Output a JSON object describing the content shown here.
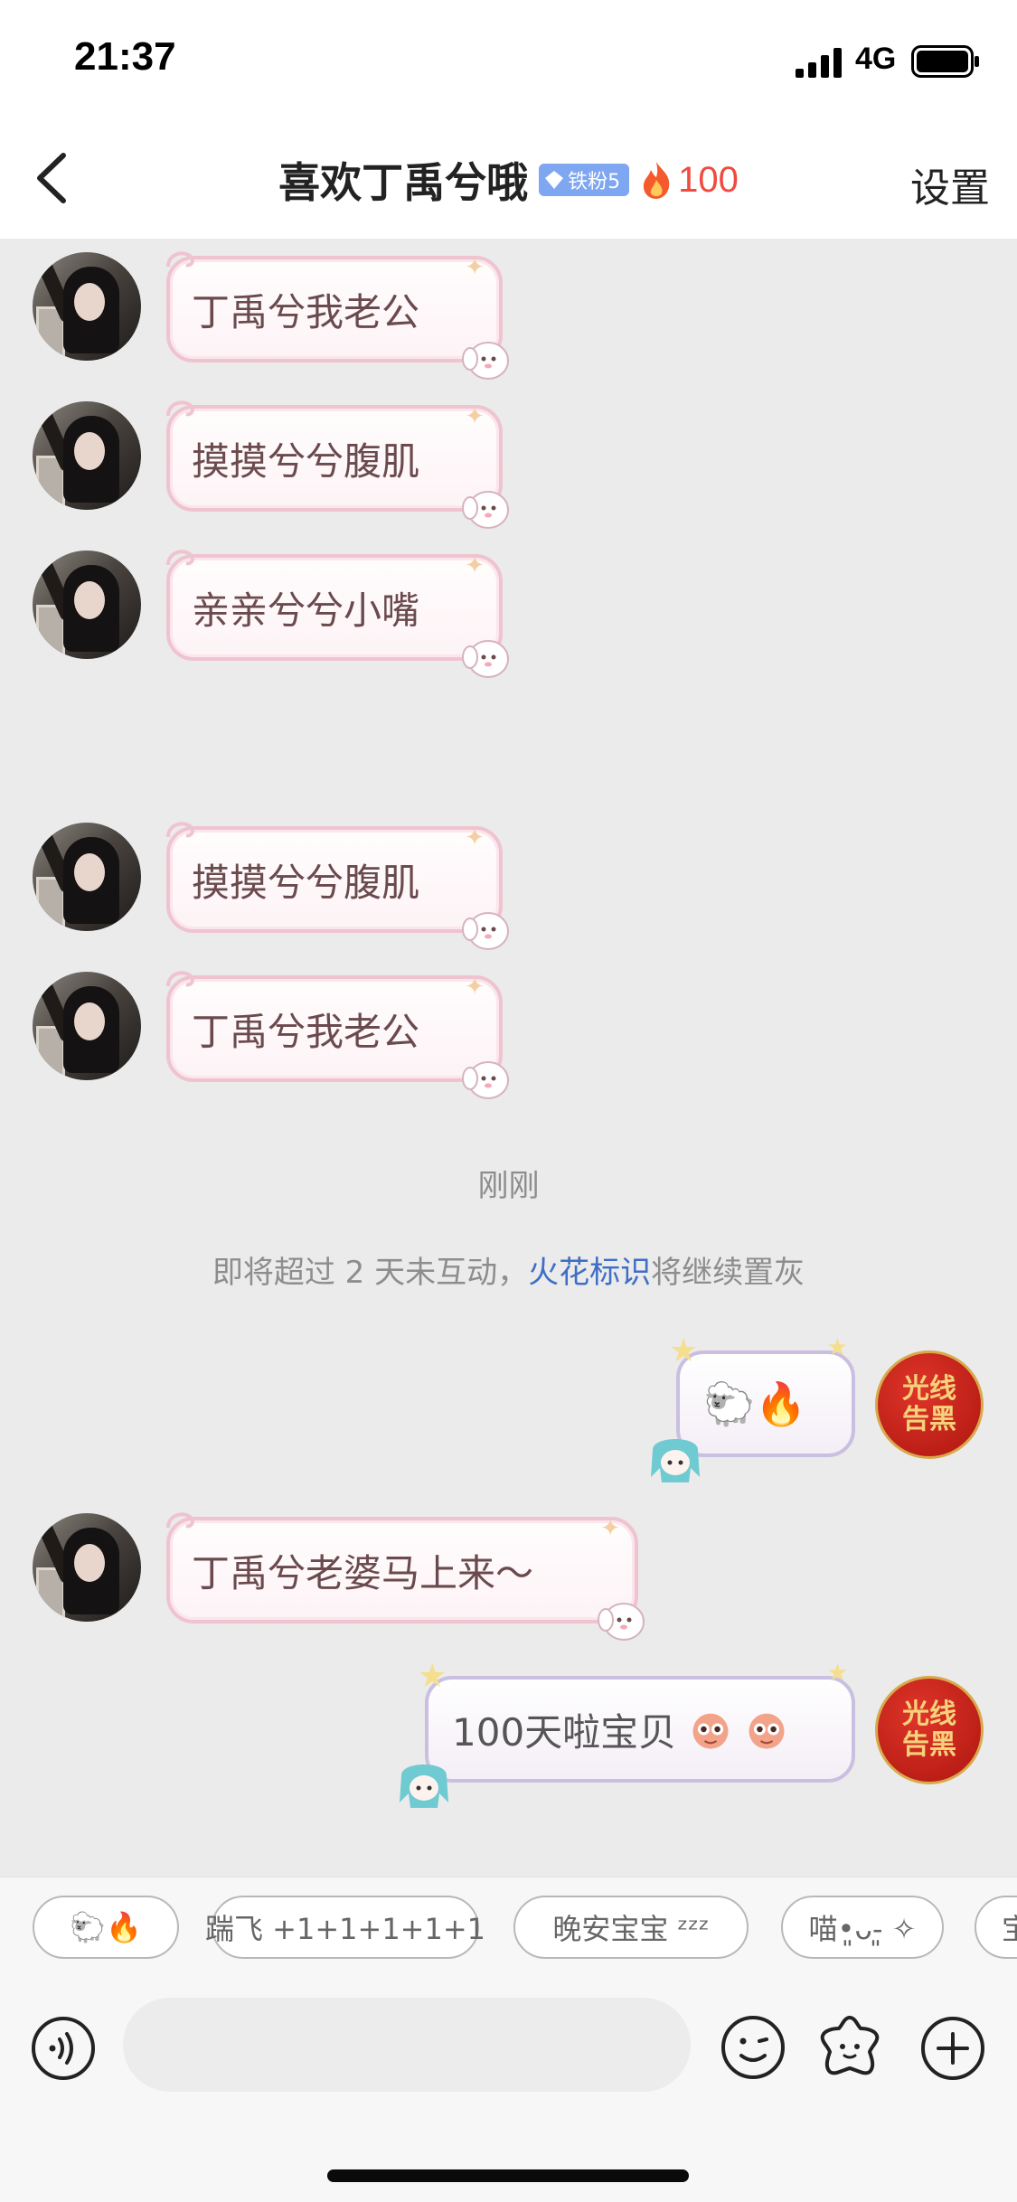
{
  "status_bar": {
    "time": "21:37",
    "network": "4G"
  },
  "nav": {
    "title": "喜欢丁禹兮哦",
    "fan_badge": "铁粉5",
    "streak": "100",
    "settings": "设置"
  },
  "messages": [
    {
      "side": "left",
      "text": "丁禹兮我老公"
    },
    {
      "side": "left",
      "text": "摸摸兮兮腹肌"
    },
    {
      "side": "left",
      "text": "亲亲兮兮小嘴"
    },
    {
      "side": "left",
      "text": "摸摸兮兮腹肌"
    },
    {
      "side": "left",
      "text": "丁禹兮我老公"
    },
    {
      "side": "right",
      "text": "🐑🔥"
    },
    {
      "side": "left",
      "text": "丁禹兮老婆马上来～"
    },
    {
      "side": "right",
      "text": "100天啦宝贝"
    }
  ],
  "self_avatar_text": [
    "光线",
    "告黑"
  ],
  "timestamp": "刚刚",
  "system_notice": {
    "before": "即将超过 2 天未互动，",
    "link": "火花标识",
    "after": "将继续置灰"
  },
  "quick_replies": [
    "🐑🔥",
    "踹飞 +1+1+1+1+1",
    "晚安宝宝 ᶻᶻᶻ",
    "喵•͈ᴗ-͈ ✧",
    "宝"
  ],
  "input": {
    "placeholder": ""
  },
  "colors": {
    "accent_fire": "#f04b3e",
    "link_blue": "#3e6ec6",
    "bubble_border_pink": "#efc3d0",
    "bubble_border_lilac": "#c9bfe0",
    "badge_blue": "#7fa6f0"
  },
  "icons": {
    "back": "chevron-left-icon",
    "fire": "fire-icon",
    "voice": "voice-icon",
    "emoji": "emoji-icon",
    "sticker": "sticker-icon",
    "plus": "plus-icon"
  }
}
